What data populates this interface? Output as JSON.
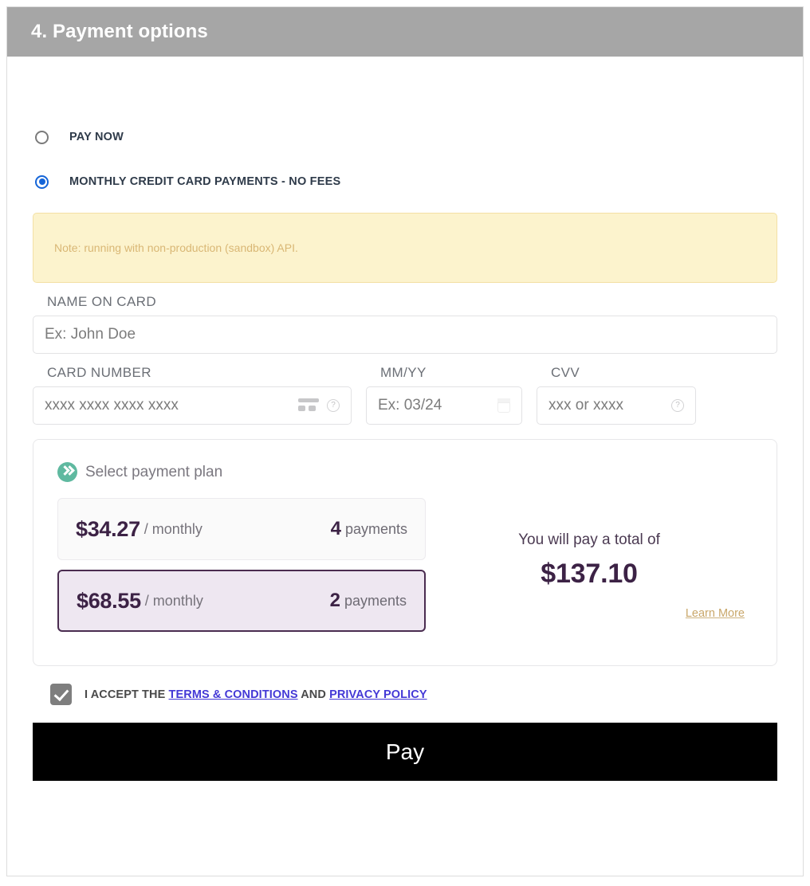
{
  "section": {
    "header_title": "4. Payment options"
  },
  "payment_options": [
    {
      "label": "PAY NOW",
      "selected": false
    },
    {
      "label": "MONTHLY CREDIT CARD PAYMENTS - NO FEES",
      "selected": true
    }
  ],
  "note": {
    "text": "Note: running with non-production (sandbox) API.",
    "background_color": "#fcf3cd",
    "text_color": "#d9b775"
  },
  "form": {
    "name_on_card": {
      "label": "NAME ON CARD",
      "placeholder": "Ex: John Doe",
      "value": ""
    },
    "card_number": {
      "label": "CARD NUMBER",
      "placeholder": "xxxx xxxx xxxx xxxx",
      "value": ""
    },
    "expiry": {
      "label": "MM/YY",
      "placeholder": "Ex: 03/24",
      "value": ""
    },
    "cvv": {
      "label": "CVV",
      "placeholder": "xxx or xxxx",
      "value": ""
    }
  },
  "plan_selector": {
    "heading": "Select payment plan",
    "brand_color": "#5fb9a0",
    "options": [
      {
        "amount": "$34.27",
        "per": "/ monthly",
        "count": "4",
        "count_word": "payments",
        "selected": false
      },
      {
        "amount": "$68.55",
        "per": "/ monthly",
        "count": "2",
        "count_word": "payments",
        "selected": true
      }
    ],
    "total_label": "You will pay a total of",
    "total_amount": "$137.10",
    "learn_more": "Learn More",
    "selected_color": "#4a2c50",
    "accent_color": "#3c2245"
  },
  "terms": {
    "checked": true,
    "prefix": "I ACCEPT THE",
    "terms_link": "TERMS & CONDITIONS",
    "conjunction": "AND",
    "privacy_link": "PRIVACY POLICY",
    "link_color": "#4338d6"
  },
  "actions": {
    "pay_label": "Pay"
  }
}
